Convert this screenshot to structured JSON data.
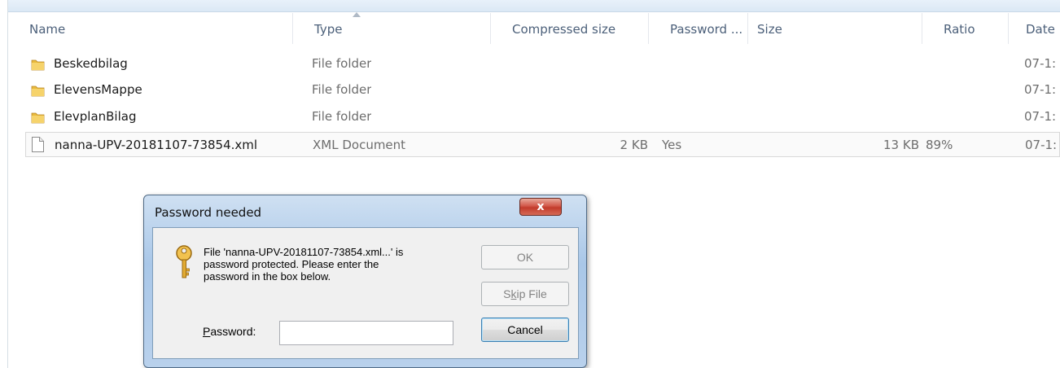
{
  "columns": [
    {
      "key": "name",
      "label": "Name"
    },
    {
      "key": "type",
      "label": "Type"
    },
    {
      "key": "compressed",
      "label": "Compressed size"
    },
    {
      "key": "password",
      "label": "Password ..."
    },
    {
      "key": "size",
      "label": "Size"
    },
    {
      "key": "ratio",
      "label": "Ratio"
    },
    {
      "key": "date",
      "label": "Date"
    }
  ],
  "rows": [
    {
      "name": "Beskedbilag",
      "type": "File folder",
      "compressed": "",
      "password": "",
      "size": "",
      "ratio": "",
      "date": "07-1:",
      "icon": "folder-icon"
    },
    {
      "name": "ElevensMappe",
      "type": "File folder",
      "compressed": "",
      "password": "",
      "size": "",
      "ratio": "",
      "date": "07-1:",
      "icon": "folder-icon"
    },
    {
      "name": "ElevplanBilag",
      "type": "File folder",
      "compressed": "",
      "password": "",
      "size": "",
      "ratio": "",
      "date": "07-1:",
      "icon": "folder-icon"
    },
    {
      "name": "nanna-UPV-20181107-73854.xml",
      "type": "XML Document",
      "compressed": "2 KB",
      "password": "Yes",
      "size": "13 KB",
      "ratio": "89%",
      "date": "07-1:",
      "icon": "file-icon"
    }
  ],
  "dialog": {
    "title": "Password needed",
    "close_label": "x",
    "message": "File 'nanna-UPV-20181107-73854.xml...' is\npassword protected.  Please enter the\npassword in the box below.",
    "ok_label": "OK",
    "skip_pre": "S",
    "skip_acc": "k",
    "skip_post": "ip File",
    "cancel_label": "Cancel",
    "password_acc": "P",
    "password_rest": "assword:",
    "password_value": ""
  },
  "colors": {
    "accent": "#1e395b",
    "close": "#c23a2b",
    "folder": "#e8b93b"
  }
}
